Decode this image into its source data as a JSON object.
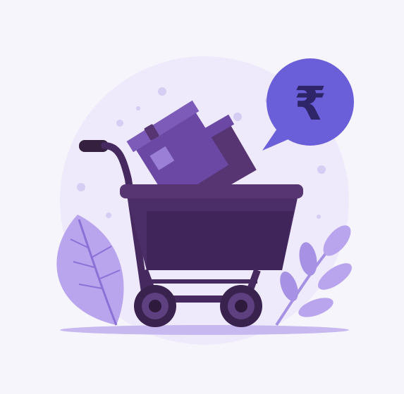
{
  "illustration": {
    "subject": "shopping-cart-with-boxes",
    "badge_symbol": "₹",
    "icons": [
      "shopping-cart-icon",
      "box-icon",
      "rupee-bubble-icon",
      "leaf-icon"
    ]
  },
  "colors": {
    "background": "#f6f5fc",
    "halo": "#efeafb",
    "cart_dark": "#45295f",
    "cart_mid": "#563572",
    "box_purple": "#6a48a3",
    "box_light": "#8e6fc8",
    "bubble": "#6a5fd9",
    "rupee_ink": "#2e2468",
    "leaf_light": "#b9a4ee",
    "leaf_mid": "#9d86e0",
    "dots": "#d6cdf3"
  }
}
